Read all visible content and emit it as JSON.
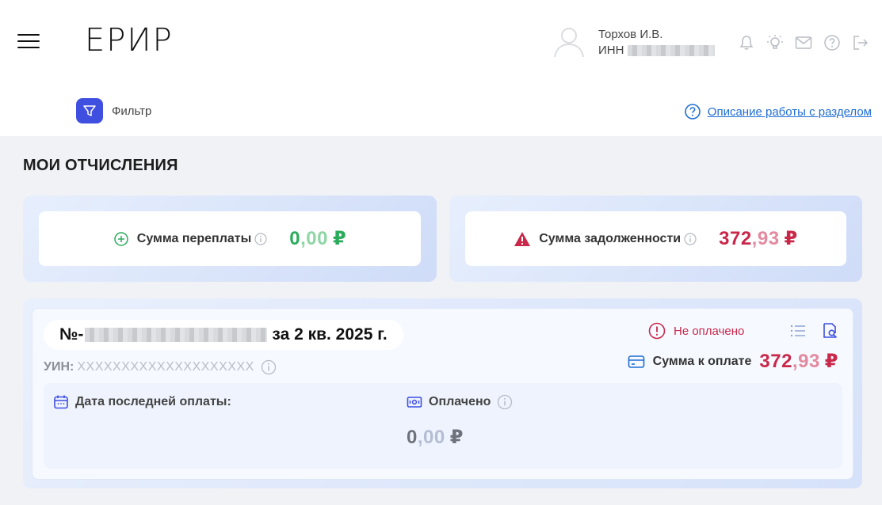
{
  "header": {
    "logo": "ЕРИР",
    "user": {
      "name": "Торхов И.В.",
      "inn_label": "ИНН"
    },
    "icons": [
      "bell-icon",
      "lightbulb-icon",
      "mail-icon",
      "help-icon",
      "logout-icon"
    ]
  },
  "toolbar": {
    "filter_label": "Фильтр",
    "help_link": "Описание работы с разделом"
  },
  "page": {
    "title": "МОИ ОТЧИСЛЕНИЯ"
  },
  "summary": {
    "overpayment": {
      "label": "Сумма переплаты",
      "int": "0",
      "dec": ",00",
      "currency": "₽",
      "color": "#2bab5b"
    },
    "debt": {
      "label": "Сумма задолженности",
      "int": "372",
      "dec": ",93",
      "currency": "₽",
      "color": "#c9284a"
    }
  },
  "charge": {
    "number_prefix": "№-",
    "period": "за 2 кв. 2025 г.",
    "uin_label": "УИН:",
    "uin_value": "XXXXXXXXXXXXXXXXXXXX",
    "status": "Не оплачено",
    "to_pay": {
      "label": "Сумма к оплате",
      "int": "372",
      "dec": ",93",
      "currency": "₽"
    },
    "last_payment_label": "Дата последней оплаты:",
    "paid": {
      "label": "Оплачено",
      "int": "0",
      "dec": ",00",
      "currency": "₽"
    }
  },
  "colors": {
    "accent": "#3f4fe0",
    "link": "#1f6ed4",
    "danger": "#c9284a",
    "success": "#2bab5b"
  }
}
